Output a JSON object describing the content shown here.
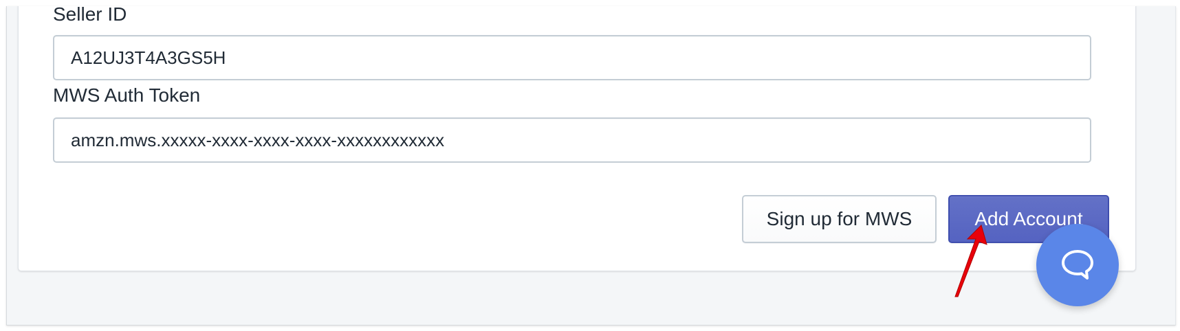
{
  "form": {
    "seller_id_label": "Seller ID",
    "seller_id_value": "A12UJ3T4A3GS5H",
    "mws_token_label": "MWS Auth Token",
    "mws_token_value": "amzn.mws.xxxxx-xxxx-xxxx-xxxx-xxxxxxxxxxxx"
  },
  "actions": {
    "signup_label": "Sign up for MWS",
    "add_account_label": "Add Account"
  },
  "icons": {
    "chat": "chat-bubble-icon",
    "annotation": "red-arrow-icon"
  },
  "colors": {
    "primary": "#5c6ac4",
    "chat": "#5a86e8",
    "arrow": "#e8000b"
  }
}
